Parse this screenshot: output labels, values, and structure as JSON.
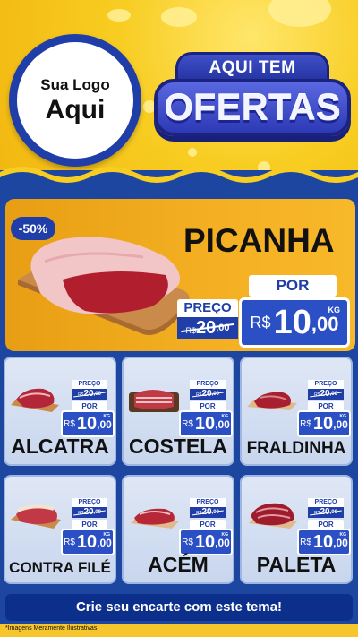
{
  "logo": {
    "line1": "Sua Logo",
    "line2": "Aqui"
  },
  "banner": {
    "top": "AQUI TEM",
    "main": "OFERTAS"
  },
  "featured": {
    "discount": "-50%",
    "name": "PICANHA",
    "preco_label": "PREÇO",
    "old_currency": "R$",
    "old_int": "20",
    "old_dec": ",00",
    "por_label": "POR",
    "new_currency": "R$",
    "new_int": "10",
    "new_dec": ",00",
    "unit": "KG"
  },
  "products": [
    {
      "name": "ALCATRA",
      "preco_label": "PREÇO",
      "old_currency": "R$",
      "old_int": "20",
      "old_dec": ",00",
      "por_label": "POR",
      "new_currency": "R$",
      "new_int": "10",
      "new_dec": ",00",
      "unit": "KG"
    },
    {
      "name": "COSTELA",
      "preco_label": "PREÇO",
      "old_currency": "R$",
      "old_int": "20",
      "old_dec": ",00",
      "por_label": "POR",
      "new_currency": "R$",
      "new_int": "10",
      "new_dec": ",00",
      "unit": "KG"
    },
    {
      "name": "FRALDINHA",
      "preco_label": "PREÇO",
      "old_currency": "R$",
      "old_int": "20",
      "old_dec": ",00",
      "por_label": "POR",
      "new_currency": "R$",
      "new_int": "10",
      "new_dec": ",00",
      "unit": "KG"
    },
    {
      "name": "CONTRA FILÉ",
      "preco_label": "PREÇO",
      "old_currency": "R$",
      "old_int": "20",
      "old_dec": ",00",
      "por_label": "POR",
      "new_currency": "R$",
      "new_int": "10",
      "new_dec": ",00",
      "unit": "KG"
    },
    {
      "name": "ACÉM",
      "preco_label": "PREÇO",
      "old_currency": "R$",
      "old_int": "20",
      "old_dec": ",00",
      "por_label": "POR",
      "new_currency": "R$",
      "new_int": "10",
      "new_dec": ",00",
      "unit": "KG"
    },
    {
      "name": "PALETA",
      "preco_label": "PREÇO",
      "old_currency": "R$",
      "old_int": "20",
      "old_dec": ",00",
      "por_label": "POR",
      "new_currency": "R$",
      "new_int": "10",
      "new_dec": ",00",
      "unit": "KG"
    }
  ],
  "cta": "Crie seu encarte com este tema!",
  "disclaimer": "*Imagens Meramente Ilustrativas",
  "colors": {
    "yellow": "#f8cd22",
    "blue": "#1c46a0",
    "dark_blue": "#0d2f8c",
    "orange": "#f4b022",
    "price_blue": "#2b4fc4"
  }
}
